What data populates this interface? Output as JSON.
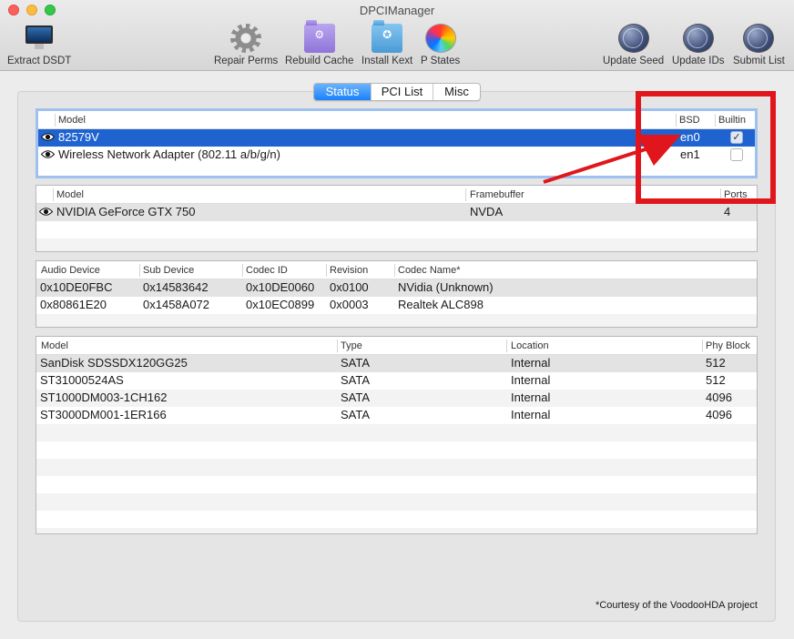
{
  "window": {
    "title": "DPCIManager"
  },
  "toolbar": {
    "items": [
      {
        "label": "Extract DSDT",
        "icon": "imac-icon"
      },
      {
        "label": "Repair Perms",
        "icon": "gear-icon"
      },
      {
        "label": "Rebuild Cache",
        "icon": "folder-cache-icon"
      },
      {
        "label": "Install Kext",
        "icon": "folder-kext-icon"
      },
      {
        "label": "P States",
        "icon": "color-wheel-icon"
      },
      {
        "label": "Update Seed",
        "icon": "globe-icon"
      },
      {
        "label": "Update IDs",
        "icon": "globe-icon"
      },
      {
        "label": "Submit List",
        "icon": "globe-icon"
      }
    ]
  },
  "tabs": [
    "Status",
    "PCI List",
    "Misc"
  ],
  "network": {
    "headers": {
      "model": "Model",
      "bsd": "BSD",
      "builtin": "Builtin"
    },
    "rows": [
      {
        "model": "82579V",
        "bsd": "en0",
        "builtin": true
      },
      {
        "model": "Wireless Network Adapter (802.11 a/b/g/n)",
        "bsd": "en1",
        "builtin": false
      }
    ]
  },
  "graphics": {
    "headers": {
      "model": "Model",
      "framebuffer": "Framebuffer",
      "ports": "Ports"
    },
    "rows": [
      {
        "model": "NVIDIA GeForce GTX 750",
        "framebuffer": "NVDA",
        "ports": "4"
      }
    ]
  },
  "audio": {
    "headers": {
      "audio_device": "Audio Device",
      "sub_device": "Sub Device",
      "codec_id": "Codec ID",
      "revision": "Revision",
      "codec_name": "Codec Name*"
    },
    "rows": [
      {
        "audio_device": "0x10DE0FBC",
        "sub_device": "0x14583642",
        "codec_id": "0x10DE0060",
        "revision": "0x0100",
        "codec_name": "NVidia (Unknown)"
      },
      {
        "audio_device": "0x80861E20",
        "sub_device": "0x1458A072",
        "codec_id": "0x10EC0899",
        "revision": "0x0003",
        "codec_name": "Realtek ALC898"
      }
    ]
  },
  "storage": {
    "headers": {
      "model": "Model",
      "type": "Type",
      "location": "Location",
      "phy_block": "Phy Block"
    },
    "rows": [
      {
        "model": "SanDisk SDSSDX120GG25",
        "type": "SATA",
        "location": "Internal",
        "phy_block": "512"
      },
      {
        "model": "ST31000524AS",
        "type": "SATA",
        "location": "Internal",
        "phy_block": "512"
      },
      {
        "model": "ST1000DM003-1CH162",
        "type": "SATA",
        "location": "Internal",
        "phy_block": "4096"
      },
      {
        "model": "ST3000DM001-1ER166",
        "type": "SATA",
        "location": "Internal",
        "phy_block": "4096"
      }
    ]
  },
  "footer": {
    "note": "*Courtesy of the VoodooHDA project"
  },
  "colors": {
    "selection": "#1f63d0",
    "accent": "#1a82fb",
    "annotation": "#e0161c"
  }
}
